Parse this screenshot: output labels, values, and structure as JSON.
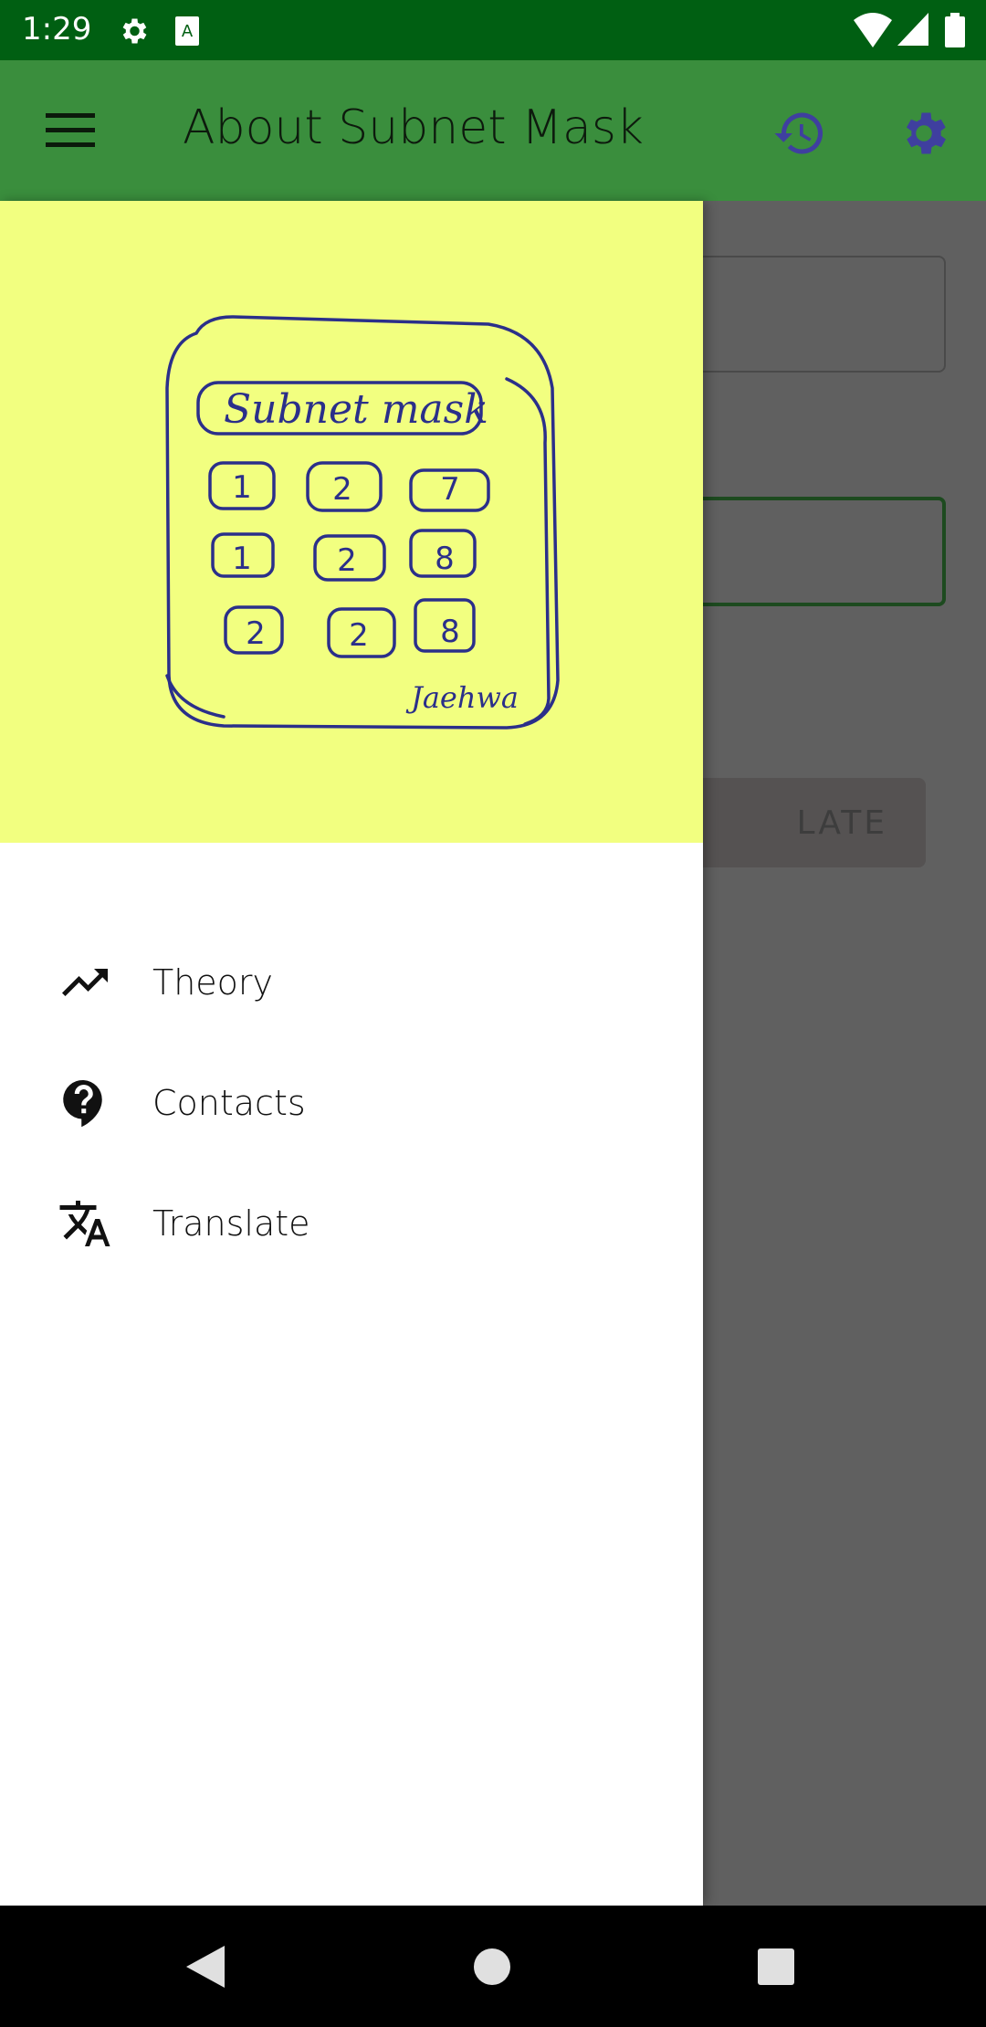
{
  "status_bar": {
    "time": "1:29",
    "icons": [
      "settings-icon",
      "text-a-icon",
      "wifi-icon",
      "signal-icon",
      "battery-icon"
    ]
  },
  "app_bar": {
    "title": "About Subnet Mask",
    "icons": [
      "menu-icon",
      "history-icon",
      "settings-icon"
    ],
    "icon_color": "#3f3f9f"
  },
  "background": {
    "button_label": "LATE"
  },
  "drawer": {
    "header_image": {
      "lettering": "Subnet mask",
      "keys": [
        "1",
        "2",
        "7",
        "1",
        "2",
        "8",
        "2",
        "2",
        "8"
      ],
      "signature": "Jaehwa"
    },
    "items": [
      {
        "label": "Theory",
        "icon": "trending-up-icon"
      },
      {
        "label": "Contacts",
        "icon": "help-icon"
      },
      {
        "label": "Translate",
        "icon": "translate-icon"
      }
    ]
  },
  "colors": {
    "status_bar": "#005f12",
    "app_bar": "#3a8e3d",
    "drawer_header": "#f2ff80",
    "scrim": "#606060"
  }
}
